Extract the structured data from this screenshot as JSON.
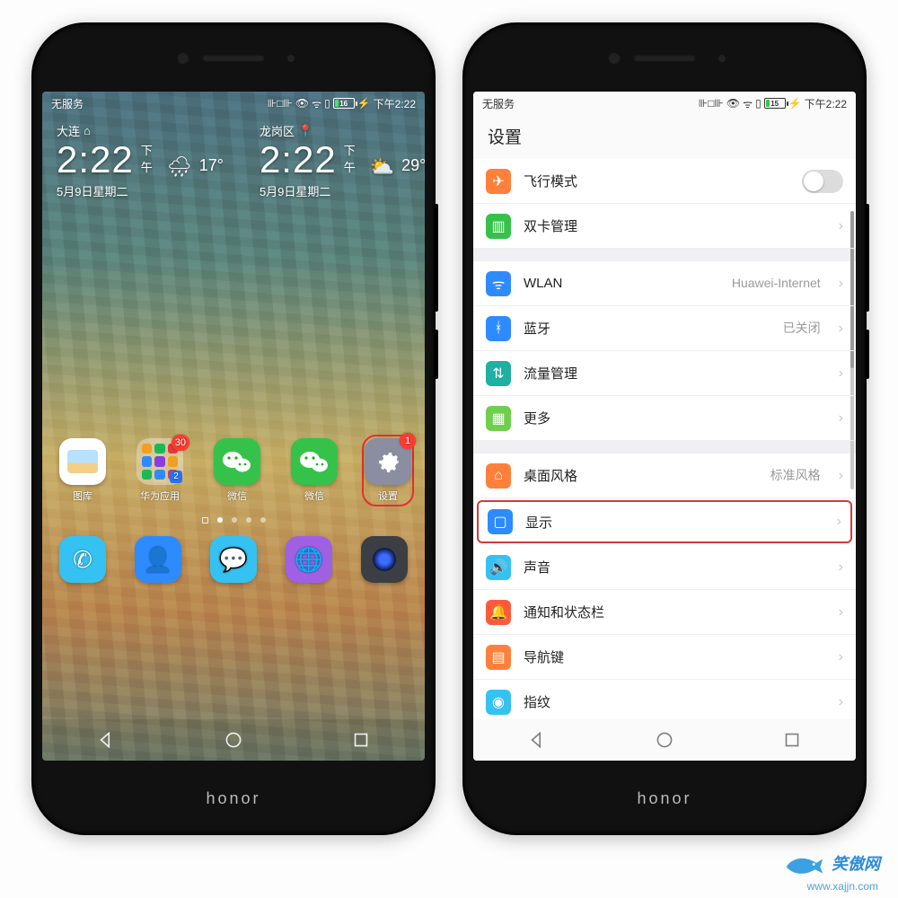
{
  "status": {
    "carrier": "无服务",
    "battery_level": "16",
    "battery_level_right": "15",
    "time": "下午2:22"
  },
  "home": {
    "clocks": [
      {
        "city": "大连",
        "time": "2:22",
        "ampm": "下午",
        "date": "5月9日星期二",
        "temp": "17°",
        "weather": "rain"
      },
      {
        "city": "龙岗区",
        "time": "2:22",
        "ampm": "下午",
        "date": "5月9日星期二",
        "temp": "29°",
        "weather": "cloud"
      }
    ],
    "apps_row": [
      {
        "name": "图库",
        "icon": "gallery-icon",
        "bg": "bg-white"
      },
      {
        "name": "华为应用",
        "icon": "folder-icon",
        "badge": "30",
        "folder_mini": "2"
      },
      {
        "name": "微信",
        "icon": "wechat-icon",
        "bg": "bg-green"
      },
      {
        "name": "微信",
        "icon": "wechat-icon",
        "bg": "bg-green"
      },
      {
        "name": "设置",
        "icon": "gear-icon",
        "bg": "bg-grey",
        "badge": "1",
        "highlight": true
      }
    ],
    "dock": [
      {
        "name": "phone",
        "icon": "phone-icon",
        "bg": "bg-sky"
      },
      {
        "name": "contacts",
        "icon": "contacts-icon",
        "bg": "bg-blue"
      },
      {
        "name": "messages",
        "icon": "chat-icon",
        "bg": "bg-sky"
      },
      {
        "name": "browser",
        "icon": "globe-icon",
        "bg": "bg-vio"
      },
      {
        "name": "camera",
        "icon": "camera-icon",
        "bg": "bg-dark"
      }
    ]
  },
  "settings": {
    "title": "设置",
    "groups": [
      [
        {
          "icon": "plane-icon",
          "icon_bg": "bg-ora",
          "label": "飞行模式",
          "type": "toggle",
          "toggle": false
        },
        {
          "icon": "sim-icon",
          "icon_bg": "bg-green",
          "label": "双卡管理"
        }
      ],
      [
        {
          "icon": "wifi-icon",
          "icon_bg": "bg-blue",
          "label": "WLAN",
          "value": "Huawei-Internet"
        },
        {
          "icon": "bluetooth-icon",
          "icon_bg": "bg-blue",
          "label": "蓝牙",
          "value": "已关闭"
        },
        {
          "icon": "data-icon",
          "icon_bg": "bg-teal",
          "label": "流量管理"
        },
        {
          "icon": "more-icon",
          "icon_bg": "bg-lime",
          "label": "更多"
        }
      ],
      [
        {
          "icon": "home-icon",
          "icon_bg": "bg-ora",
          "label": "桌面风格",
          "value": "标准风格"
        },
        {
          "icon": "display-icon",
          "icon_bg": "bg-blue",
          "label": "显示",
          "highlight": true
        },
        {
          "icon": "sound-icon",
          "icon_bg": "bg-sky",
          "label": "声音"
        },
        {
          "icon": "bell-icon",
          "icon_bg": "bg-red",
          "label": "通知和状态栏"
        },
        {
          "icon": "navkey-icon",
          "icon_bg": "bg-ora",
          "label": "导航键"
        },
        {
          "icon": "fingerprint-icon",
          "icon_bg": "bg-sky",
          "label": "指纹"
        }
      ]
    ]
  },
  "watermark": {
    "name": "笑傲网",
    "url": "www.xajjn.com"
  },
  "glyph": {
    "gallery-icon": "🖼",
    "wechat-icon": "✳",
    "gear-icon": "⚙",
    "phone-icon": "✆",
    "contacts-icon": "👤",
    "chat-icon": "💬",
    "globe-icon": "🌐",
    "camera-icon": "📷",
    "plane-icon": "✈",
    "sim-icon": "▥",
    "wifi-icon": "ᯤ",
    "bluetooth-icon": "ᚼ",
    "data-icon": "⇅",
    "more-icon": "▦",
    "home-icon": "⌂",
    "display-icon": "▢",
    "sound-icon": "🔊",
    "bell-icon": "🔔",
    "navkey-icon": "▤",
    "fingerprint-icon": "◉"
  }
}
